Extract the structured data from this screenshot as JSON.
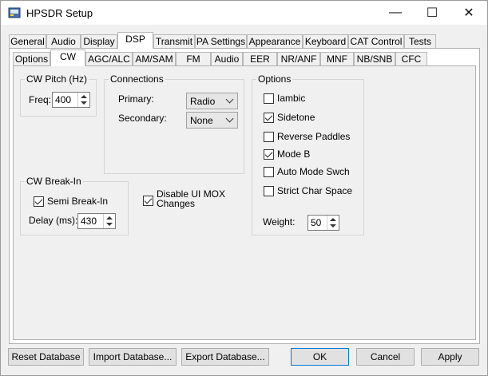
{
  "window": {
    "title": "HPSDR Setup",
    "icon": "app-window-icon"
  },
  "title_controls": {
    "minimize": "—",
    "maximize": "☐",
    "close": "✕"
  },
  "top_tabs": [
    {
      "label": "General"
    },
    {
      "label": "Audio"
    },
    {
      "label": "Display"
    },
    {
      "label": "DSP",
      "selected": true
    },
    {
      "label": "Transmit"
    },
    {
      "label": "PA Settings"
    },
    {
      "label": "Appearance"
    },
    {
      "label": "Keyboard"
    },
    {
      "label": "CAT Control"
    },
    {
      "label": "Tests"
    }
  ],
  "sub_tabs": [
    {
      "label": "Options"
    },
    {
      "label": "CW",
      "selected": true
    },
    {
      "label": "AGC/ALC"
    },
    {
      "label": "AM/SAM"
    },
    {
      "label": "FM"
    },
    {
      "label": "Audio"
    },
    {
      "label": "EER"
    },
    {
      "label": "NR/ANF"
    },
    {
      "label": "MNF"
    },
    {
      "label": "NB/SNB"
    },
    {
      "label": "CFC"
    }
  ],
  "cw_pitch": {
    "title": "CW Pitch (Hz)",
    "freq_label": "Freq:",
    "freq_value": "400"
  },
  "connections": {
    "title": "Connections",
    "primary_label": "Primary:",
    "primary_value": "Radio",
    "secondary_label": "Secondary:",
    "secondary_value": "None"
  },
  "options": {
    "title": "Options",
    "items": [
      {
        "label": "Iambic",
        "checked": false
      },
      {
        "label": "Sidetone",
        "checked": true
      },
      {
        "label": "Reverse Paddles",
        "checked": false
      },
      {
        "label": "Mode B",
        "checked": true
      },
      {
        "label": "Auto Mode Swch",
        "checked": false
      },
      {
        "label": "Strict Char Space",
        "checked": false
      }
    ],
    "weight_label": "Weight:",
    "weight_value": "50"
  },
  "cw_break_in": {
    "title": "CW Break-In",
    "semi_label": "Semi Break-In",
    "semi_checked": true,
    "delay_label": "Delay (ms):",
    "delay_value": "430"
  },
  "disable_ui_mox": {
    "line1": "Disable UI MOX",
    "line2": "Changes",
    "checked": true
  },
  "buttons": {
    "reset": "Reset Database",
    "import": "Import Database...",
    "export": "Export Database...",
    "ok": "OK",
    "cancel": "Cancel",
    "apply": "Apply"
  }
}
